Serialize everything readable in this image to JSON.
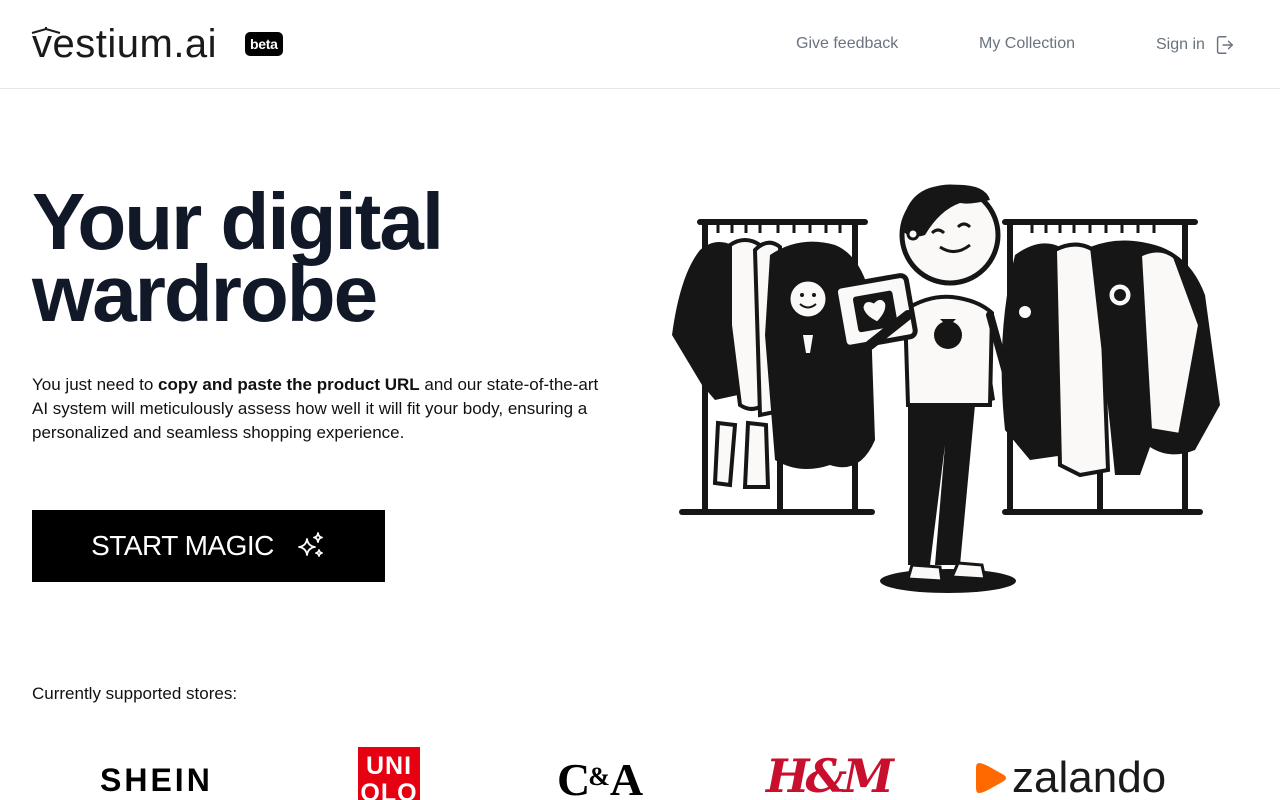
{
  "header": {
    "logo_text": "vestium.ai",
    "badge": "beta",
    "nav": {
      "feedback": "Give feedback",
      "collection": "My Collection",
      "signin": "Sign in"
    }
  },
  "hero": {
    "title": "Your digital wardrobe",
    "description_before": "You just need to ",
    "description_bold": "copy and paste the product URL",
    "description_after": " and our state-of-the-art AI system will meticulously assess how well it will fit your body, ensuring a personalized and seamless shopping experience.",
    "cta_label": "START MAGIC",
    "illustration": "person-holding-tablet-between-clothing-racks"
  },
  "stores": {
    "label": "Currently supported stores:",
    "items": {
      "shein": "SHEIN",
      "uniqlo_line1": "UNI",
      "uniqlo_line2": "QLO",
      "ca_c": "C",
      "ca_amp": "&",
      "ca_a": "A",
      "hm": "H&M",
      "zalando": "zalando"
    }
  },
  "colors": {
    "accent": "#000000",
    "uniqlo": "#e60012",
    "hm": "#c8102e",
    "zalando": "#ff6900"
  }
}
